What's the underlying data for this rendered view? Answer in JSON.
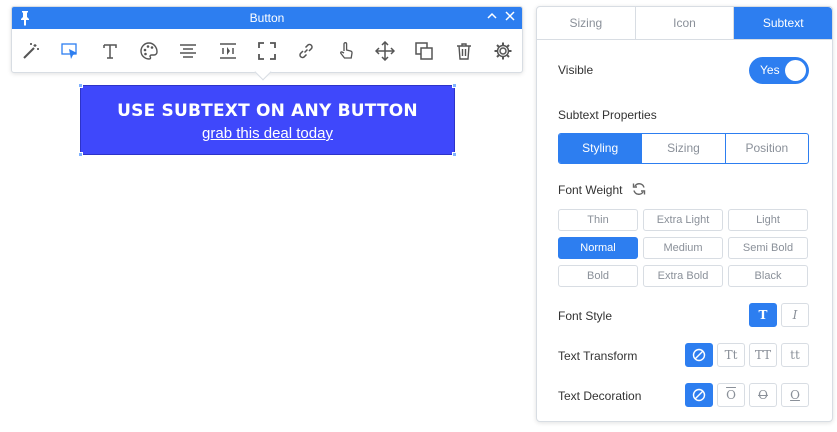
{
  "toolbar": {
    "title": "Button",
    "icons": [
      "magic-wand-icon",
      "cursor-select-icon",
      "typography-icon",
      "palette-icon",
      "align-center-icon",
      "text-width-icon",
      "fullscreen-icon",
      "link-icon",
      "hand-pointer-icon",
      "move-icon",
      "duplicate-icon",
      "trash-icon",
      "gear-icon"
    ]
  },
  "preview": {
    "main_text": "USE SUBTEXT ON ANY BUTTON",
    "sub_text": "grab this deal today",
    "bg_color": "#3f48fb"
  },
  "panel": {
    "tabs": [
      {
        "label": "Sizing",
        "active": false
      },
      {
        "label": "Icon",
        "active": false
      },
      {
        "label": "Subtext",
        "active": true
      }
    ],
    "visible_label": "Visible",
    "visible_value": "Yes",
    "subtext_properties_label": "Subtext Properties",
    "subtabs": [
      {
        "label": "Styling",
        "active": true
      },
      {
        "label": "Sizing",
        "active": false
      },
      {
        "label": "Position",
        "active": false
      }
    ],
    "font_weight_label": "Font Weight",
    "font_weights": [
      {
        "label": "Thin",
        "active": false
      },
      {
        "label": "Extra Light",
        "active": false
      },
      {
        "label": "Light",
        "active": false
      },
      {
        "label": "Normal",
        "active": true
      },
      {
        "label": "Medium",
        "active": false
      },
      {
        "label": "Semi Bold",
        "active": false
      },
      {
        "label": "Bold",
        "active": false
      },
      {
        "label": "Extra Bold",
        "active": false
      },
      {
        "label": "Black",
        "active": false
      }
    ],
    "font_style_label": "Font Style",
    "font_style_options": [
      "T",
      "I"
    ],
    "text_transform_label": "Text Transform",
    "text_transform_options": [
      "none",
      "Tt",
      "TT",
      "tt"
    ],
    "text_decoration_label": "Text Decoration",
    "text_decoration_options": [
      "none",
      "O",
      "O",
      "O"
    ]
  },
  "colors": {
    "accent": "#2d7ef0",
    "border": "#d8dde3",
    "muted_text": "#8a9099"
  }
}
